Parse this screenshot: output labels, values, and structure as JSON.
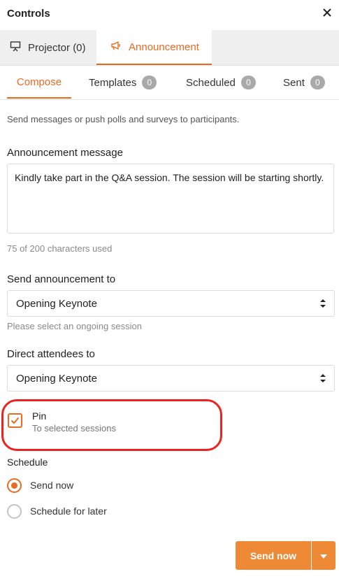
{
  "header": {
    "title": "Controls",
    "close_icon": "close-icon"
  },
  "top_tabs": [
    {
      "label": "Projector (0)",
      "icon": "projector-icon",
      "active": false
    },
    {
      "label": "Announcement",
      "icon": "megaphone-icon",
      "active": true
    }
  ],
  "sub_tabs": [
    {
      "label": "Compose",
      "badge": null,
      "active": true
    },
    {
      "label": "Templates",
      "badge": "0",
      "active": false
    },
    {
      "label": "Scheduled",
      "badge": "0",
      "active": false
    },
    {
      "label": "Sent",
      "badge": "0",
      "active": false
    }
  ],
  "description": "Send messages or push polls and surveys to participants.",
  "message": {
    "label": "Announcement message",
    "value": "Kindly take part in the Q&A session. The session will be starting shortly.",
    "char_count": "75 of 200 characters used"
  },
  "send_to": {
    "label": "Send announcement to",
    "selected": "Opening Keynote",
    "helper": "Please select an ongoing session"
  },
  "direct_to": {
    "label": "Direct attendees to",
    "selected": "Opening Keynote"
  },
  "pin": {
    "label": "Pin",
    "sublabel": "To selected sessions",
    "checked": true
  },
  "schedule": {
    "label": "Schedule",
    "options": [
      {
        "label": "Send now",
        "selected": true
      },
      {
        "label": "Schedule for later",
        "selected": false
      }
    ]
  },
  "actions": {
    "send_label": "Send now"
  },
  "colors": {
    "accent": "#ea6a22",
    "button": "#ee8a35",
    "highlight": "#e8261f"
  }
}
